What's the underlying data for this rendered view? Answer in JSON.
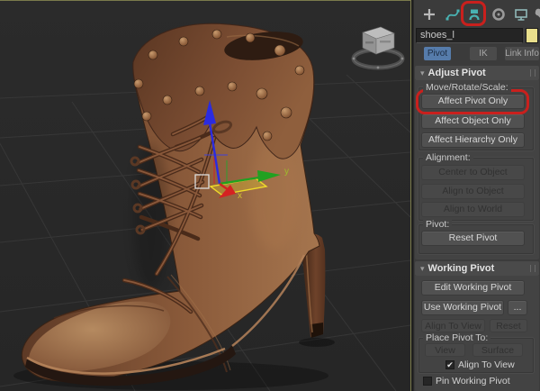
{
  "command_panel": {
    "tabs": [
      {
        "name": "create"
      },
      {
        "name": "modify"
      },
      {
        "name": "hierarchy",
        "selected": true,
        "annotated": true
      },
      {
        "name": "motion"
      },
      {
        "name": "display"
      },
      {
        "name": "utilities"
      }
    ],
    "object_name": "shoes_l",
    "object_color": "#e9df8c",
    "subtabs": {
      "pivot": "Pivot",
      "ik": "IK",
      "link_info": "Link Info",
      "selected": "Pivot"
    },
    "rollouts": {
      "adjust_pivot": {
        "title": "Adjust Pivot",
        "move_rotate_scale": {
          "label": "Move/Rotate/Scale:",
          "affect_pivot_only": "Affect Pivot Only",
          "affect_object_only": "Affect Object Only",
          "affect_hierarchy_only": "Affect Hierarchy Only"
        },
        "alignment": {
          "label": "Alignment:",
          "center_to_object": "Center to Object",
          "align_to_object": "Align to Object",
          "align_to_world": "Align to World"
        },
        "pivot": {
          "label": "Pivot:",
          "reset_pivot": "Reset Pivot"
        }
      },
      "working_pivot": {
        "title": "Working Pivot",
        "edit_working_pivot": "Edit Working Pivot",
        "use_working_pivot": "Use Working Pivot",
        "ellipsis": "...",
        "align_to_view": "Align To View",
        "reset": "Reset",
        "place_pivot_to": {
          "label": "Place Pivot To:",
          "view": "View",
          "surface": "Surface",
          "align_to_view_checkbox": {
            "label": "Align To View",
            "checked": true
          }
        },
        "pin_working_pivot": {
          "label": "Pin Working Pivot",
          "checked": false
        }
      }
    }
  },
  "viewport": {
    "object": "brown high-heel ankle boot with studded cuff and laces",
    "gizmo_axis_labels": {
      "x": "x",
      "y": "y"
    },
    "active_border_color": "#7b7b4c"
  },
  "annotations": {
    "highlight_color": "#c9201d",
    "targets": [
      "hierarchy-panel-icon",
      "affect-pivot-only-button"
    ]
  },
  "icons": {
    "rollout_open": "▾",
    "check": "✔"
  }
}
